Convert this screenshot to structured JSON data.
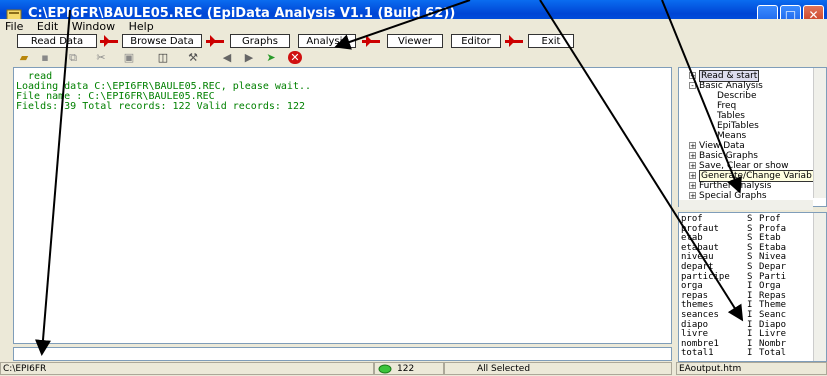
{
  "window": {
    "title": "C:\\EPI6FR\\BAULE05.REC (EpiData Analysis V1.1 (Build 62))",
    "buttons": [
      "_",
      "□",
      "✕"
    ]
  },
  "menu": [
    "File",
    "Edit",
    "Window",
    "Help"
  ],
  "toolbar": {
    "read_data": "Read Data",
    "browse_data": "Browse Data",
    "graphs": "Graphs",
    "analysis": "Analysis",
    "viewer": "Viewer",
    "editor": "Editor",
    "exit": "Exit"
  },
  "output_lines": [
    "  read",
    "Loading data C:\\EPI6FR\\BAULE05.REC, please wait..",
    "File name : C:\\EPI6FR\\BAULE05.REC",
    "Fields: 39 Total records: 122 Valid records: 122"
  ],
  "tree": {
    "items": [
      {
        "label": "Read & start",
        "toggle": "+",
        "indent": 0,
        "style": "sel"
      },
      {
        "label": "Basic Analysis",
        "toggle": "-",
        "indent": 0,
        "style": ""
      },
      {
        "label": "Describe",
        "toggle": "",
        "indent": 2,
        "style": ""
      },
      {
        "label": "Freq",
        "toggle": "",
        "indent": 2,
        "style": ""
      },
      {
        "label": "Tables",
        "toggle": "",
        "indent": 2,
        "style": ""
      },
      {
        "label": "EpiTables",
        "toggle": "",
        "indent": 2,
        "style": ""
      },
      {
        "label": "Means",
        "toggle": "",
        "indent": 2,
        "style": ""
      },
      {
        "label": "View Data",
        "toggle": "+",
        "indent": 0,
        "style": ""
      },
      {
        "label": "Basic Graphs",
        "toggle": "+",
        "indent": 0,
        "style": ""
      },
      {
        "label": "Save, Clear or show",
        "toggle": "+",
        "indent": 0,
        "style": ""
      },
      {
        "label": "Generate/Change Variab",
        "toggle": "+",
        "indent": 0,
        "style": "hl"
      },
      {
        "label": "Further Analysis",
        "toggle": "+",
        "indent": 0,
        "style": ""
      },
      {
        "label": "Special Graphs",
        "toggle": "+",
        "indent": 0,
        "style": ""
      }
    ]
  },
  "variables": [
    {
      "name": "prof",
      "type": "S",
      "label": "Prof"
    },
    {
      "name": "profaut",
      "type": "S",
      "label": "Profa"
    },
    {
      "name": "etab",
      "type": "S",
      "label": "Etab"
    },
    {
      "name": "etabaut",
      "type": "S",
      "label": "Etaba"
    },
    {
      "name": "niveau",
      "type": "S",
      "label": "Nivea"
    },
    {
      "name": "depart",
      "type": "S",
      "label": "Depar"
    },
    {
      "name": "participe",
      "type": "S",
      "label": "Parti"
    },
    {
      "name": "orga",
      "type": "I",
      "label": "Orga"
    },
    {
      "name": "repas",
      "type": "I",
      "label": "Repas"
    },
    {
      "name": "themes",
      "type": "I",
      "label": "Theme"
    },
    {
      "name": "seances",
      "type": "I",
      "label": "Seanc"
    },
    {
      "name": "diapo",
      "type": "I",
      "label": "Diapo"
    },
    {
      "name": "livre",
      "type": "I",
      "label": "Livre"
    },
    {
      "name": "nombre1",
      "type": "I",
      "label": "Nombr"
    },
    {
      "name": "total1",
      "type": "I",
      "label": "Total"
    }
  ],
  "status": {
    "path": "C:\\EPI6FR",
    "records": "122",
    "selection": "All Selected",
    "output_file": "EAoutput.htm"
  },
  "colors": {
    "title_bar": "#0046d5",
    "output_text": "#008000",
    "arrow_red": "#cc0000",
    "record_indicator": "#3cc43c"
  }
}
